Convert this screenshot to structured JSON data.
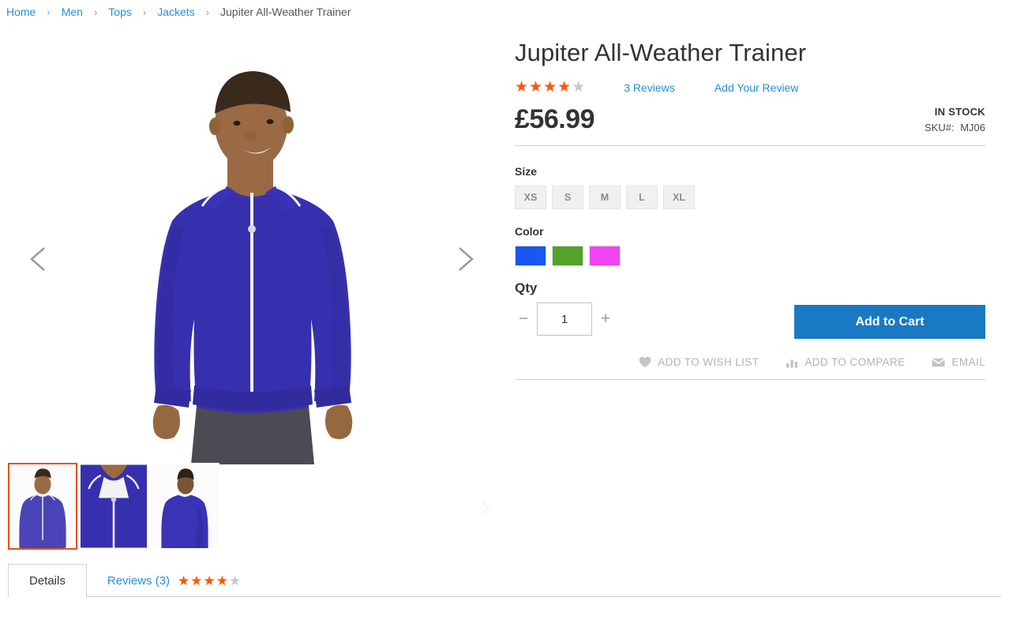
{
  "breadcrumb": {
    "separator": "›",
    "items": [
      {
        "label": "Home",
        "link": true
      },
      {
        "label": "Men",
        "link": true
      },
      {
        "label": "Tops",
        "link": true
      },
      {
        "label": "Jackets",
        "link": true
      },
      {
        "label": "Jupiter All-Weather Trainer",
        "link": false
      }
    ]
  },
  "gallery": {
    "prev_arrow_icon": "chevron-left-icon",
    "next_arrow_icon": "chevron-right-icon",
    "thumbs_next_icon": "chevron-right-icon",
    "thumbnails": [
      {
        "name": "front-view",
        "selected": true
      },
      {
        "name": "closeup-view",
        "selected": false
      },
      {
        "name": "back-view",
        "selected": false
      }
    ]
  },
  "product": {
    "title": "Jupiter All-Weather Trainer",
    "rating": {
      "stars_filled": 4,
      "stars_total": 5,
      "star_glyph": "★",
      "filled_color": "#ff5501",
      "empty_color": "#c7c7c7"
    },
    "reviews_link": "3 Reviews",
    "add_review_link": "Add Your Review",
    "price": "£56.99",
    "stock_status": "IN STOCK",
    "sku_label": "SKU#:",
    "sku_value": "MJ06"
  },
  "options": {
    "size": {
      "label": "Size",
      "values": [
        "XS",
        "S",
        "M",
        "L",
        "XL"
      ]
    },
    "color": {
      "label": "Color",
      "values": [
        {
          "name": "blue",
          "hex": "#1857f0"
        },
        {
          "name": "green",
          "hex": "#53a32a"
        },
        {
          "name": "magenta",
          "hex": "#f045f0"
        }
      ]
    }
  },
  "cart": {
    "qty_label": "Qty",
    "qty_value": "1",
    "qty_decrement": "−",
    "qty_increment": "+",
    "add_to_cart_label": "Add to Cart",
    "add_to_cart_color": "#1979c3"
  },
  "actions": [
    {
      "label": "ADD TO WISH LIST",
      "icon": "heart-icon"
    },
    {
      "label": "ADD TO COMPARE",
      "icon": "bar-chart-icon"
    },
    {
      "label": "EMAIL",
      "icon": "envelope-icon"
    }
  ],
  "tabs": [
    {
      "label": "Details",
      "active": true
    },
    {
      "label": "Reviews (3)",
      "active": false,
      "stars_filled": 4,
      "stars_total": 5
    }
  ]
}
